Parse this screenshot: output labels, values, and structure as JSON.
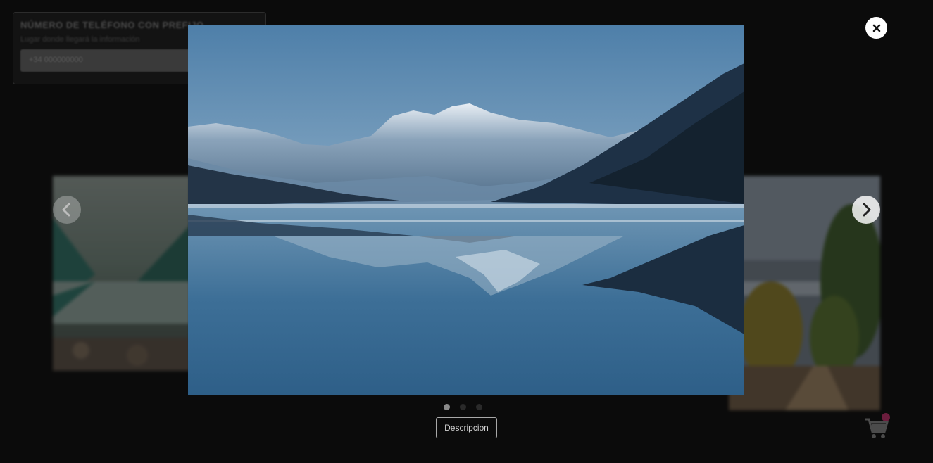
{
  "background_page": {
    "title": "NÚMERO DE TELÉFONO CON PREFIJO",
    "subtitle": "Lugar donde llegará la información",
    "input_placeholder": "+34 000000000"
  },
  "lightbox": {
    "close_icon": "close-icon",
    "prev_icon": "chevron-left-icon",
    "next_icon": "chevron-right-icon",
    "main_image": "mountain-lake-reflection",
    "left_preview_image": "misty-mountain-lake",
    "right_preview_image": "forest-path-trees",
    "dots": [
      {
        "active": true
      },
      {
        "active": false
      },
      {
        "active": false
      }
    ],
    "description_button": "Descripcion"
  },
  "cart": {
    "icon": "shopping-cart-icon",
    "badge_color": "#e0337a"
  }
}
